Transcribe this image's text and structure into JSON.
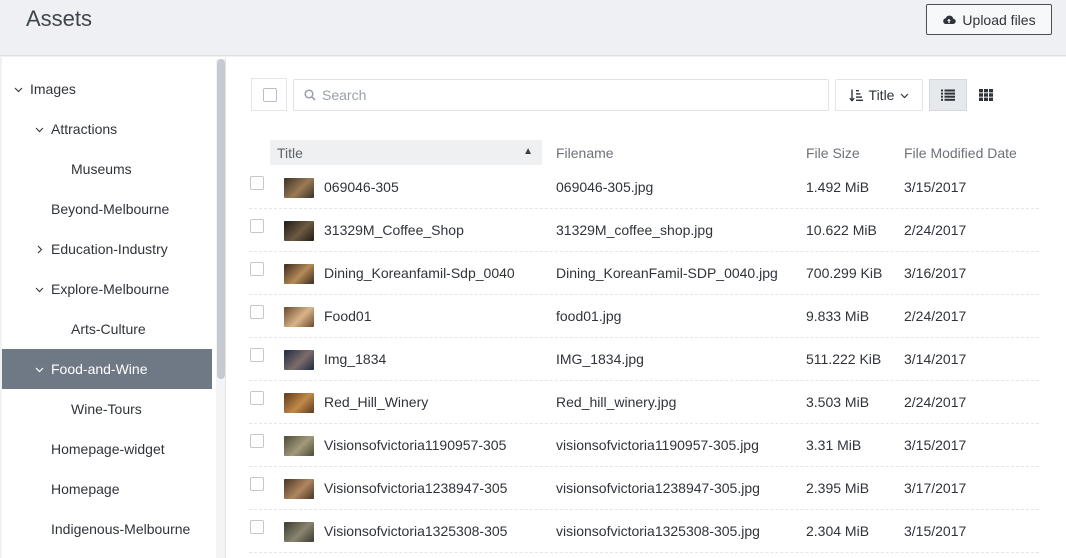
{
  "header": {
    "title": "Assets",
    "upload_label": "Upload files"
  },
  "sidebar": {
    "items": [
      {
        "label": "Images",
        "level": 0,
        "chevron": "down"
      },
      {
        "label": "Attractions",
        "level": 1,
        "chevron": "down"
      },
      {
        "label": "Museums",
        "level": 2,
        "chevron": ""
      },
      {
        "label": "Beyond-Melbourne",
        "level": 1,
        "chevron": ""
      },
      {
        "label": "Education-Industry",
        "level": 1,
        "chevron": "right"
      },
      {
        "label": "Explore-Melbourne",
        "level": 1,
        "chevron": "down"
      },
      {
        "label": "Arts-Culture",
        "level": 2,
        "chevron": ""
      },
      {
        "label": "Food-and-Wine",
        "level": 1,
        "chevron": "down",
        "selected": true
      },
      {
        "label": "Wine-Tours",
        "level": 2,
        "chevron": ""
      },
      {
        "label": "Homepage-widget",
        "level": 1,
        "chevron": ""
      },
      {
        "label": "Homepage",
        "level": 1,
        "chevron": ""
      },
      {
        "label": "Indigenous-Melbourne",
        "level": 1,
        "chevron": ""
      }
    ]
  },
  "toolbar": {
    "search_placeholder": "Search",
    "sort_label": "Title"
  },
  "table": {
    "columns": [
      "Title",
      "Filename",
      "File Size",
      "File Modified Date"
    ],
    "rows": [
      {
        "title": "069046-305",
        "filename": "069046-305.jpg",
        "size": "1.492 MiB",
        "date": "3/15/2017",
        "thumb": [
          "#3b3127",
          "#9a7a55"
        ]
      },
      {
        "title": "31329M_Coffee_Shop",
        "filename": "31329M_coffee_shop.jpg",
        "size": "10.622 MiB",
        "date": "2/24/2017",
        "thumb": [
          "#1f1a16",
          "#6e5a44"
        ]
      },
      {
        "title": "Dining_Koreanfamil-Sdp_0040",
        "filename": "Dining_KoreanFamil-SDP_0040.jpg",
        "size": "700.299 KiB",
        "date": "3/16/2017",
        "thumb": [
          "#3a2a1e",
          "#b58a57"
        ]
      },
      {
        "title": "Food01",
        "filename": "food01.jpg",
        "size": "9.833 MiB",
        "date": "2/24/2017",
        "thumb": [
          "#6a4a2e",
          "#d9b488"
        ]
      },
      {
        "title": "Img_1834",
        "filename": "IMG_1834.jpg",
        "size": "511.222 KiB",
        "date": "3/14/2017",
        "thumb": [
          "#1e2a44",
          "#7d6c6a"
        ]
      },
      {
        "title": "Red_Hill_Winery",
        "filename": "Red_hill_winery.jpg",
        "size": "3.503 MiB",
        "date": "2/24/2017",
        "thumb": [
          "#5a3a1e",
          "#c2894a"
        ]
      },
      {
        "title": "Visionsofvictoria1190957-305",
        "filename": "visionsofvictoria1190957-305.jpg",
        "size": "3.31 MiB",
        "date": "3/15/2017",
        "thumb": [
          "#4a4a3a",
          "#a39a7a"
        ]
      },
      {
        "title": "Visionsofvictoria1238947-305",
        "filename": "visionsofvictoria1238947-305.jpg",
        "size": "2.395 MiB",
        "date": "3/17/2017",
        "thumb": [
          "#4a3424",
          "#b08660"
        ]
      },
      {
        "title": "Visionsofvictoria1325308-305",
        "filename": "visionsofvictoria1325308-305.jpg",
        "size": "2.304 MiB",
        "date": "3/15/2017",
        "thumb": [
          "#3a3a30",
          "#8a8470"
        ]
      }
    ]
  }
}
